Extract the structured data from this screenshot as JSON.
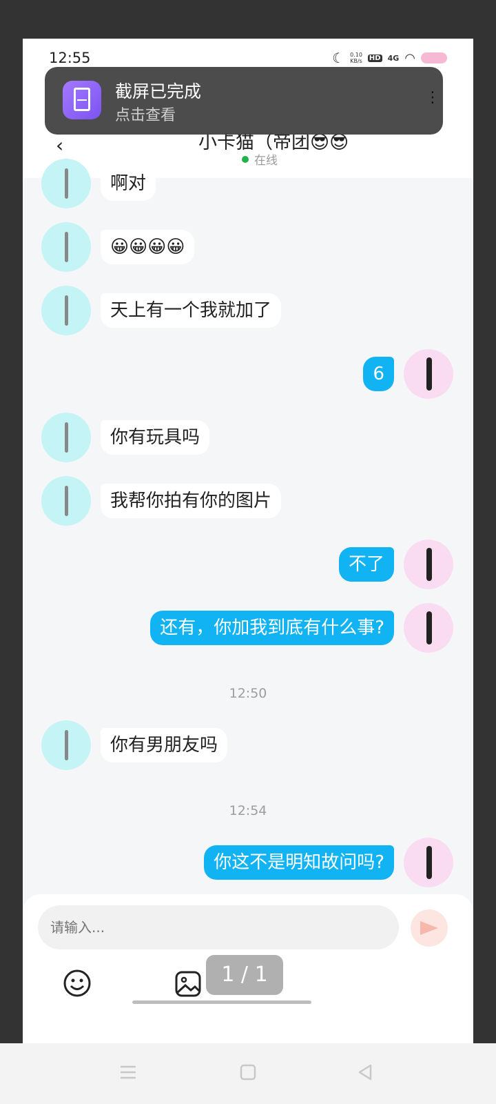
{
  "status_bar": {
    "time": "12:55",
    "net_speed": "0.10",
    "net_unit": "KB/s",
    "hd": "HD",
    "network": "4G"
  },
  "header": {
    "title": "小卡猫（帝团😎😎",
    "status": "在线"
  },
  "toast": {
    "title": "截屏已完成",
    "subtitle": "点击查看"
  },
  "messages": [
    {
      "side": "left",
      "text": "啊对"
    },
    {
      "side": "left",
      "text": "😀😀😀😀"
    },
    {
      "side": "left",
      "text": "天上有一个我就加了"
    },
    {
      "side": "right",
      "text": "6"
    },
    {
      "side": "left",
      "text": "你有玩具吗"
    },
    {
      "side": "left",
      "text": "我帮你拍有你的图片"
    },
    {
      "side": "right",
      "text": "不了"
    },
    {
      "side": "right",
      "text": "还有，你加我到底有什么事?"
    },
    {
      "side": "left",
      "text": "你有男朋友吗"
    },
    {
      "side": "right",
      "text": "你这不是明知故问吗?"
    }
  ],
  "time_dividers": [
    "12:50",
    "12:54"
  ],
  "composer": {
    "placeholder": "请输入...",
    "pager": "1 / 1"
  },
  "colors": {
    "outgoing_bubble": "#12b3f3",
    "incoming_bubble": "#ffffff",
    "left_avatar_bg": "#c4f4f6",
    "right_avatar_bg": "#f9dcf2"
  }
}
